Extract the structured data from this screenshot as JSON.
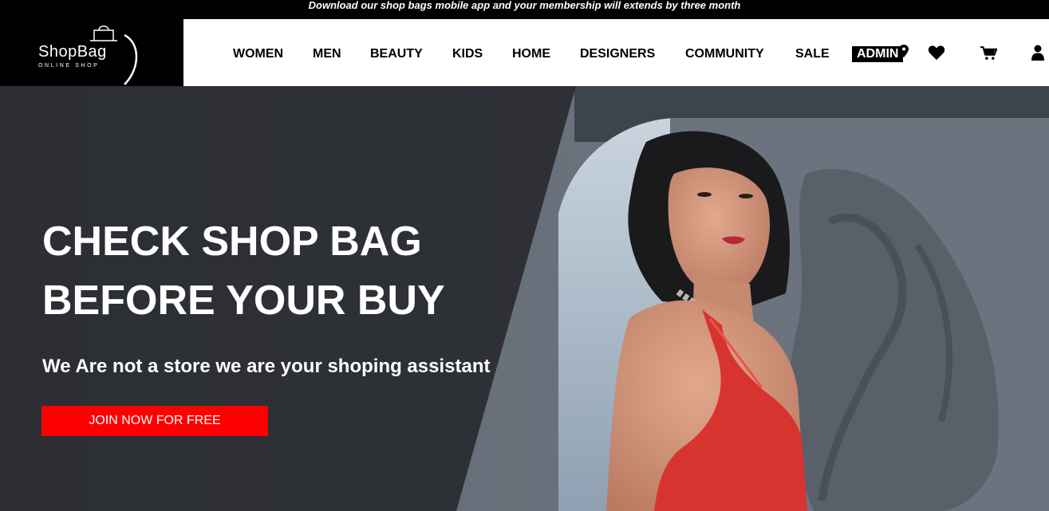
{
  "promo": {
    "text": "Download our shop bags mobile app and your membership will extends by three month"
  },
  "brand": {
    "name": "ShopBag",
    "tagline": "ONLINE SHOP"
  },
  "nav": {
    "items": [
      {
        "label": "WOMEN"
      },
      {
        "label": "MEN"
      },
      {
        "label": "BEAUTY"
      },
      {
        "label": "KIDS"
      },
      {
        "label": "HOME"
      },
      {
        "label": "DESIGNERS"
      },
      {
        "label": "COMMUNITY"
      },
      {
        "label": "SALE"
      }
    ],
    "admin_label": "ADMIN"
  },
  "icons": {
    "wishlist": "heart-icon",
    "cart": "cart-icon",
    "account": "user-icon"
  },
  "hero": {
    "title_line1": "CHECK SHOP BAG",
    "title_line2": "BEFORE YOUR BUY",
    "subtitle": "We Are not a store we are your shoping assistant",
    "cta_label": "JOIN NOW FOR FREE"
  },
  "colors": {
    "accent": "#ff0000",
    "header_bg": "#000000"
  }
}
